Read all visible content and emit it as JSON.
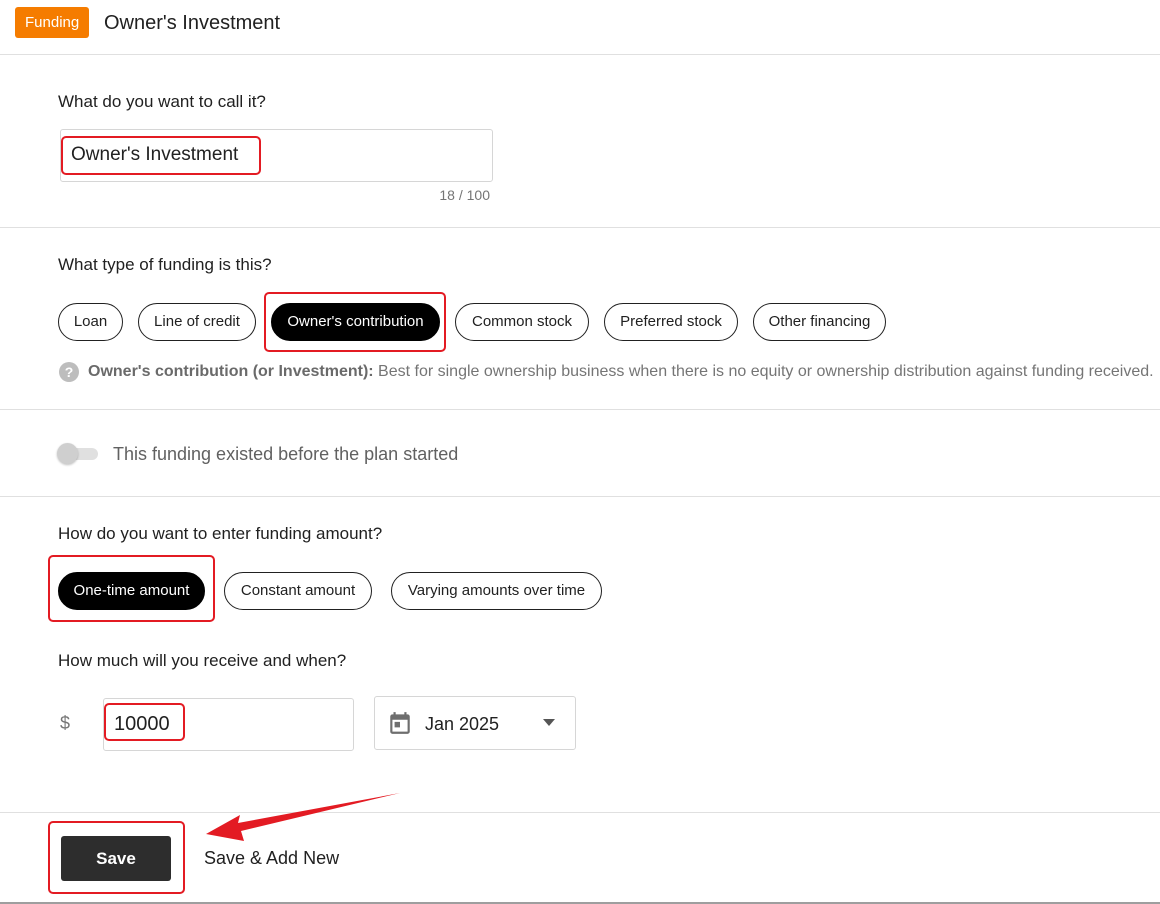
{
  "header": {
    "badge": "Funding",
    "title": "Owner's Investment"
  },
  "name_section": {
    "question": "What do you want to call it?",
    "value": "Owner's Investment",
    "counter": "18 / 100"
  },
  "type_section": {
    "question": "What type of funding is this?",
    "options": [
      "Loan",
      "Line of credit",
      "Owner's contribution",
      "Common stock",
      "Preferred stock",
      "Other financing"
    ],
    "selected": "Owner's contribution",
    "help_title": "Owner's contribution (or Investment):",
    "help_body": " Best for single ownership business when there is no equity or ownership distribution against funding received."
  },
  "toggle": {
    "label": "This funding existed before the plan started",
    "on": false
  },
  "entry_section": {
    "question": "How do you want to enter funding amount?",
    "options": [
      "One-time amount",
      "Constant amount",
      "Varying amounts over time"
    ],
    "selected": "One-time amount"
  },
  "amount_section": {
    "question": "How much will you receive and when?",
    "currency": "$",
    "amount": "10000",
    "date": "Jan 2025"
  },
  "footer": {
    "save": "Save",
    "save_new": "Save & Add New"
  },
  "colors": {
    "badge": "#f57c00",
    "highlight": "#e31b23",
    "selected_pill": "#000000",
    "save_button": "#2d2d2d"
  }
}
